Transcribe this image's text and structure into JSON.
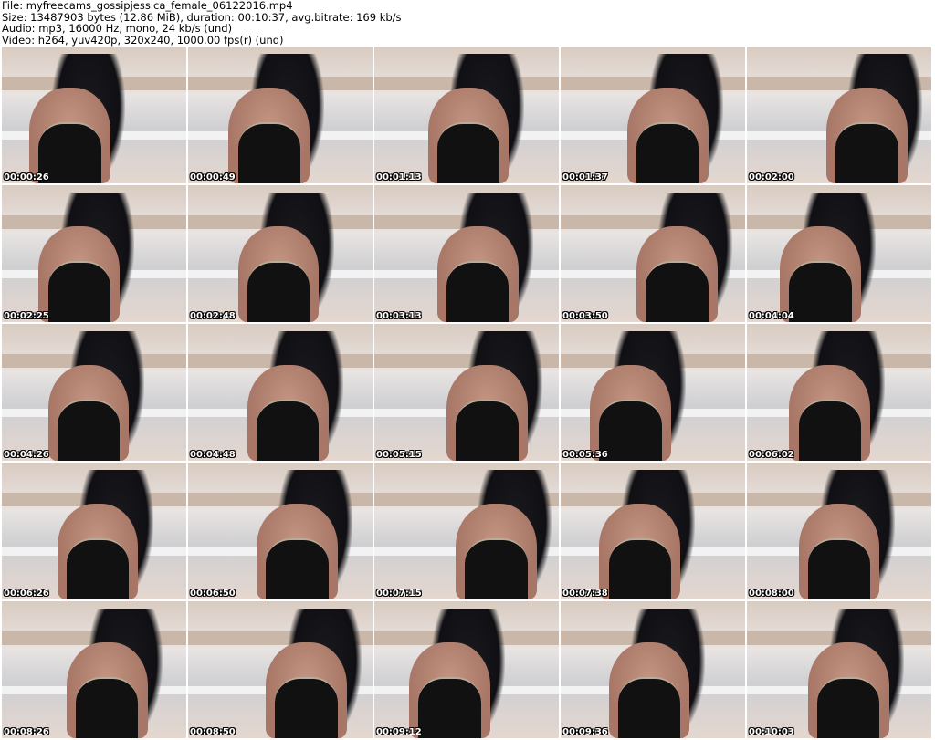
{
  "header": {
    "file": "File: myfreecams_gossipjessica_female_06122016.mp4",
    "size": "Size: 13487903 bytes (12.86 MiB), duration: 00:10:37, avg.bitrate: 169 kb/s",
    "audio": "Audio: mp3, 16000 Hz, mono, 24 kb/s (und)",
    "video": "Video: h264, yuv420p, 320x240, 1000.00 fps(r) (und)"
  },
  "thumbnails": [
    "00:00:26",
    "00:00:49",
    "00:01:13",
    "00:01:37",
    "00:02:00",
    "00:02:25",
    "00:02:48",
    "00:03:13",
    "00:03:50",
    "00:04:04",
    "00:04:26",
    "00:04:48",
    "00:05:15",
    "00:05:36",
    "00:06:02",
    "00:06:26",
    "00:06:50",
    "00:07:15",
    "00:07:38",
    "00:08:00",
    "00:08:26",
    "00:08:50",
    "00:09:12",
    "00:09:36",
    "00:10:03"
  ]
}
